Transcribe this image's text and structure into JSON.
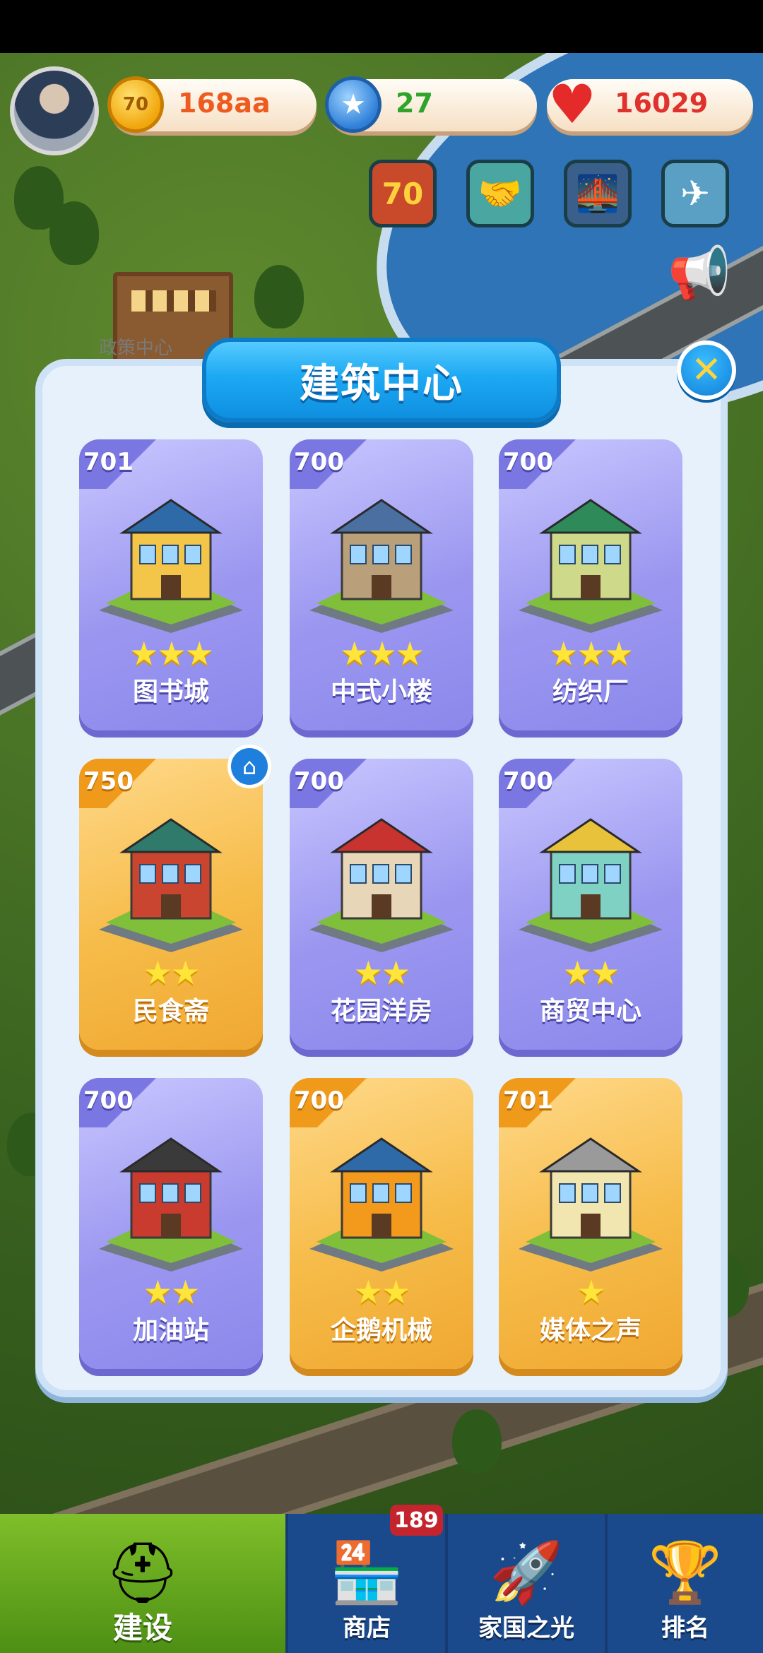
{
  "map": {
    "label": "政策中心"
  },
  "hud": {
    "coins": {
      "icon": "coin-icon",
      "glyph": "70",
      "value": "168aa"
    },
    "stars": {
      "icon": "star-icon",
      "glyph": "★",
      "value": "27"
    },
    "hearts": {
      "icon": "heart-icon",
      "glyph": "♥",
      "value": "16029"
    }
  },
  "shortcuts": [
    {
      "name": "anniversary-70-icon",
      "glyph": "70"
    },
    {
      "name": "handshake-icon",
      "glyph": "🤝"
    },
    {
      "name": "bridge-icon",
      "glyph": "🌉"
    },
    {
      "name": "airplane-icon",
      "glyph": "✈"
    }
  ],
  "speaker": {
    "glyph": "📢"
  },
  "dialog": {
    "title": "建筑中心",
    "close_glyph": "✕",
    "home_glyph": "⌂",
    "cards": [
      {
        "num": "701",
        "stars": "★★★",
        "name": "图书城",
        "gold": false,
        "color": "#f3c64a",
        "roof": "#2f6aa8"
      },
      {
        "num": "700",
        "stars": "★★★",
        "name": "中式小楼",
        "gold": false,
        "color": "#b9a07a",
        "roof": "#4a6fa0"
      },
      {
        "num": "700",
        "stars": "★★★",
        "name": "纺织厂",
        "gold": false,
        "color": "#cfd98a",
        "roof": "#2f8a5a"
      },
      {
        "num": "750",
        "stars": "★★",
        "name": "民食斋",
        "gold": true,
        "color": "#c9452f",
        "roof": "#2f7a6a"
      },
      {
        "num": "700",
        "stars": "★★",
        "name": "花园洋房",
        "gold": false,
        "color": "#e8d6b8",
        "roof": "#c9332f"
      },
      {
        "num": "700",
        "stars": "★★",
        "name": "商贸中心",
        "gold": false,
        "color": "#7fd1c4",
        "roof": "#e8c23a"
      },
      {
        "num": "700",
        "stars": "★★",
        "name": "加油站",
        "gold": false,
        "color": "#c93a2f",
        "roof": "#3a3a3a"
      },
      {
        "num": "700",
        "stars": "★★",
        "name": "企鹅机械",
        "gold": true,
        "color": "#f39a1c",
        "roof": "#2f6aa8"
      },
      {
        "num": "701",
        "stars": "★",
        "name": "媒体之声",
        "gold": true,
        "color": "#f1e6b0",
        "roof": "#9a9a9a"
      }
    ]
  },
  "nav": {
    "items": [
      {
        "label": "建设",
        "glyph": "⛑",
        "active": true
      },
      {
        "label": "商店",
        "glyph": "🏪",
        "active": false
      },
      {
        "label": "家国之光",
        "glyph": "🚀",
        "active": false
      },
      {
        "label": "排名",
        "glyph": "🏆",
        "active": false
      }
    ],
    "shop_badge": "189"
  }
}
